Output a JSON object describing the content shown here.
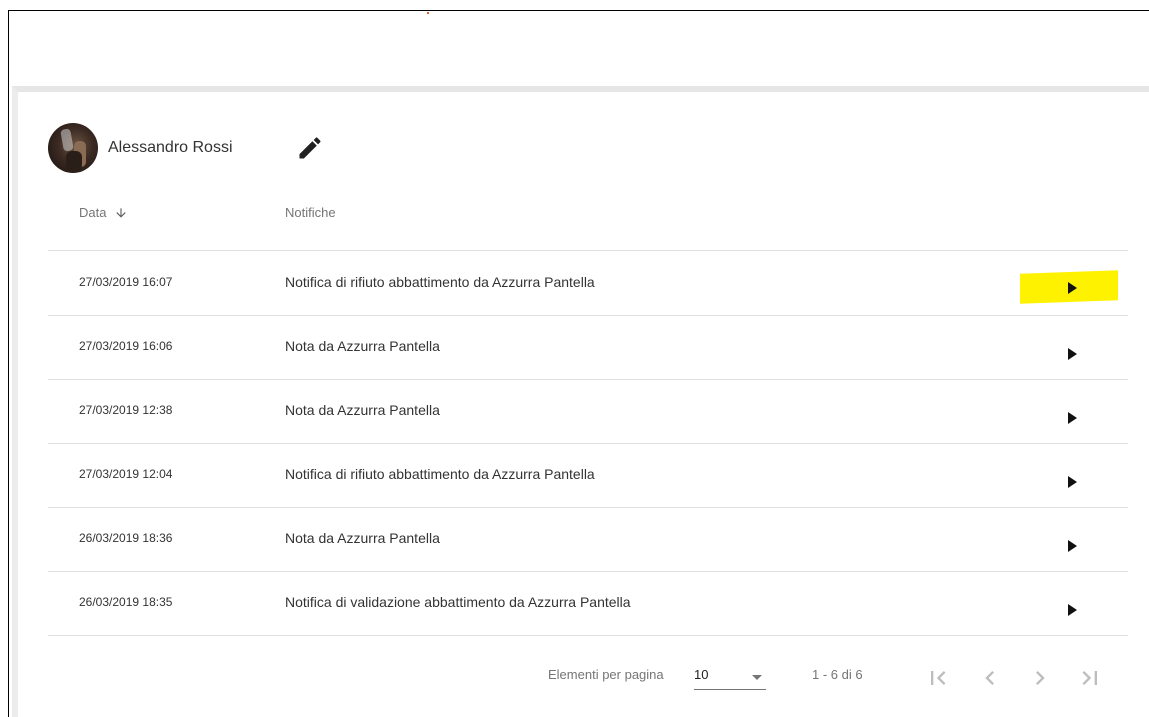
{
  "user": {
    "name": "Alessandro Rossi"
  },
  "table": {
    "headers": {
      "date": "Data",
      "notifications": "Notifiche"
    },
    "rows": [
      {
        "date": "27/03/2019 16:07",
        "text": "Notifica di rifiuto abbattimento da Azzurra Pantella"
      },
      {
        "date": "27/03/2019 16:06",
        "text": "Nota da Azzurra Pantella"
      },
      {
        "date": "27/03/2019 12:38",
        "text": "Nota da Azzurra Pantella"
      },
      {
        "date": "27/03/2019 12:04",
        "text": "Notifica di rifiuto abbattimento da Azzurra Pantella"
      },
      {
        "date": "26/03/2019 18:36",
        "text": "Nota da Azzurra Pantella"
      },
      {
        "date": "26/03/2019 18:35",
        "text": "Notifica di validazione abbattimento da Azzurra Pantella"
      }
    ]
  },
  "paginator": {
    "items_per_page_label": "Elementi per pagina",
    "page_size": "10",
    "range": "1 - 6 di 6"
  },
  "icons": {
    "edit": "pencil-icon",
    "sort": "arrow-down-icon",
    "row_action": "play-arrow-icon",
    "first": "first-page-icon",
    "prev": "chevron-left-icon",
    "next": "chevron-right-icon",
    "last": "last-page-icon"
  },
  "colors": {
    "highlight": "#fff200",
    "divider": "#e0e0e0"
  }
}
